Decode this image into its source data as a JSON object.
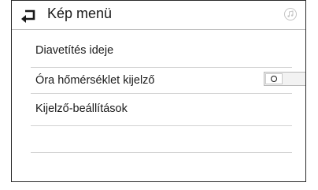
{
  "header": {
    "title": "Kép menü",
    "back_icon": "back-arrow-icon",
    "media_icon": "music-note-icon"
  },
  "menu": {
    "items": [
      {
        "label": "Diavetítés ideje"
      },
      {
        "label": "Óra hőmérséklet kijelző",
        "toggle": {
          "state": "off",
          "icon": "circle-icon"
        }
      },
      {
        "label": "Kijelző-beállítások"
      }
    ]
  },
  "colors": {
    "border": "#2a2a2a",
    "separator": "#d2d2d2",
    "text": "#1a1a1a"
  }
}
